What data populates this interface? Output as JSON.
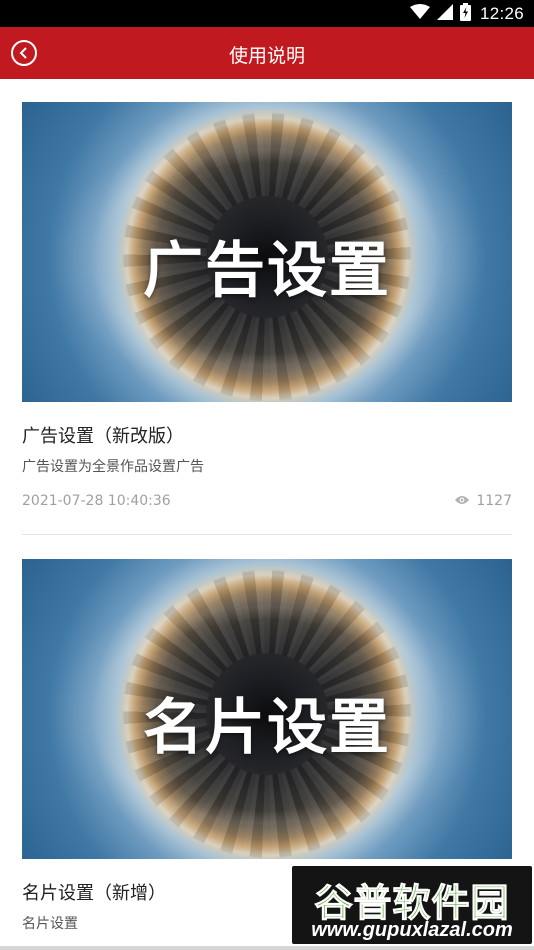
{
  "status_bar": {
    "time": "12:26",
    "icons": [
      "wifi-icon",
      "cellular-signal-icon",
      "battery-icon"
    ]
  },
  "app_bar": {
    "title": "使用说明",
    "back_icon": "back-icon",
    "background_color": "#c0191f"
  },
  "articles": [
    {
      "thumbnail_text": "广告设置",
      "title": "广告设置（新改版）",
      "description": "广告设置为全景作品设置广告",
      "date": "2021-07-28 10:40:36",
      "views": "1127",
      "views_icon": "eye-icon"
    },
    {
      "thumbnail_text": "名片设置",
      "title": "名片设置（新增）",
      "description": "名片设置"
    }
  ],
  "watermark": {
    "logo_text": "谷普软件园",
    "url": "www.gupuxlazal.com"
  }
}
